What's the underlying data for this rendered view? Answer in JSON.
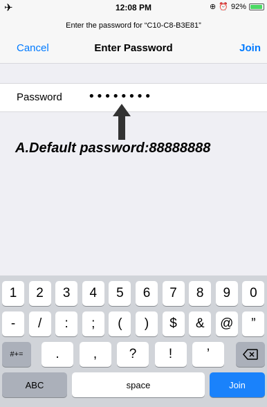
{
  "status": {
    "airplane_icon": "airplane-icon",
    "time": "12:08 PM",
    "battery": "92%",
    "battery_level": 0.92
  },
  "header": {
    "prompt": "Enter the password for “C10-C8-B3E81”",
    "cancel": "Cancel",
    "title": "Enter Password",
    "join": "Join"
  },
  "form": {
    "password_label": "Password",
    "password_value": "••••••••"
  },
  "annotation": {
    "text": "A.Default password:88888888"
  },
  "keyboard": {
    "row1": [
      "1",
      "2",
      "3",
      "4",
      "5",
      "6",
      "7",
      "8",
      "9",
      "0"
    ],
    "row2": [
      "-",
      "/",
      ":",
      ";",
      "(",
      ")",
      "$",
      "&",
      "@",
      "”"
    ],
    "row3": {
      "symbols": "#+=",
      "keys": [
        ".",
        ",",
        "?",
        "!",
        "’"
      ],
      "delete_icon": "backspace-icon"
    },
    "row4": {
      "abc": "ABC",
      "space": "space",
      "join": "Join"
    }
  },
  "colors": {
    "accent": "#007aff",
    "join_key": "#1a82fb",
    "keyboard_bg": "#d1d4d9",
    "battery": "#4cd964"
  }
}
